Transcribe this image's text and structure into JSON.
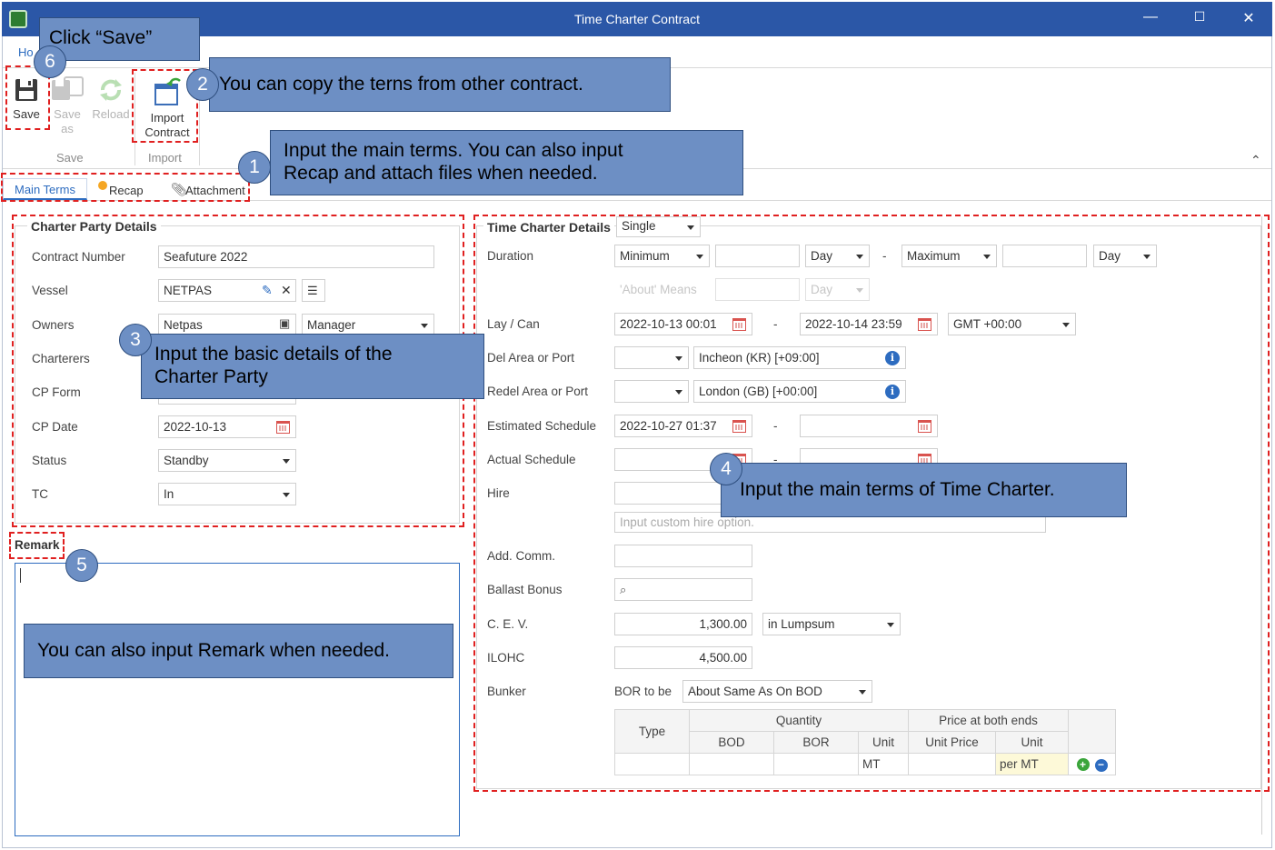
{
  "window": {
    "title": "Time Charter Contract",
    "minimize": "—",
    "maximize": "☐",
    "close": "✕"
  },
  "ribbon": {
    "home_tab": "Ho",
    "buttons": {
      "save": "Save",
      "save_as_1": "Save",
      "save_as_2": "as",
      "reload": "Reload",
      "import_1": "Import",
      "import_2": "Contract"
    },
    "groups": {
      "save": "Save",
      "import": "Import"
    },
    "collapse": "⌃"
  },
  "tabs": {
    "main_terms": "Main Terms",
    "recap": "Recap",
    "attachment": "Attachment"
  },
  "charter_party": {
    "title": "Charter Party Details",
    "contract_number_label": "Contract Number",
    "contract_number": "Seafuture 2022",
    "vessel_label": "Vessel",
    "vessel": "NETPAS",
    "owners_label": "Owners",
    "owners": "Netpas",
    "owners_role": "Manager",
    "charterers_label": "Charterers",
    "cp_form_label": "CP Form",
    "cp_date_label": "CP Date",
    "cp_date": "2022-10-13",
    "status_label": "Status",
    "status": "Standby",
    "tc_label": "TC",
    "tc": "In"
  },
  "remark": {
    "label": "Remark"
  },
  "time_charter": {
    "title": "Time Charter Details",
    "type": "Single",
    "duration_label": "Duration",
    "duration_min": "Minimum",
    "day_unit_1": "Day",
    "dash": "-",
    "duration_max": "Maximum",
    "day_unit_2": "Day",
    "about_means_placeholder": "'About' Means",
    "day_unit_3": "Day",
    "laycan_label": "Lay / Can",
    "lay_from": "2022-10-13 00:01",
    "lay_to": "2022-10-14 23:59",
    "timezone": "GMT +00:00",
    "del_label": "Del Area or Port",
    "del_port": "Incheon (KR) [+09:00]",
    "redel_label": "Redel Area or Port",
    "redel_port": "London (GB) [+00:00]",
    "est_label": "Estimated Schedule",
    "est_from": "2022-10-27 01:37",
    "act_label": "Actual Schedule",
    "hire_label": "Hire",
    "hire_custom_placeholder": "Input custom hire option.",
    "addcomm_label": "Add. Comm.",
    "ballast_label": "Ballast Bonus",
    "cev_label": "C. E. V.",
    "cev": "1,300.00",
    "cev_basis": "in Lumpsum",
    "ilohc_label": "ILOHC",
    "ilohc": "4,500.00",
    "bunker_label": "Bunker",
    "bor_label": "BOR to be",
    "bor_value": "About Same As On BOD",
    "table": {
      "type": "Type",
      "quantity": "Quantity",
      "price": "Price at both ends",
      "bod": "BOD",
      "bor": "BOR",
      "unit": "Unit",
      "unit_price": "Unit Price",
      "unit2": "Unit",
      "row_unit": "MT",
      "row_price_unit": "per MT"
    }
  },
  "callouts": {
    "c1": {
      "num": "1",
      "line1": "Input the main terms. You can also input",
      "line2": "Recap and attach files when needed."
    },
    "c2": {
      "num": "2",
      "text": "You can copy the terns from other contract."
    },
    "c3": {
      "num": "3",
      "line1": "Input the basic details of the",
      "line2": "Charter Party"
    },
    "c4": {
      "num": "4",
      "text": "Input the main terms of Time Charter."
    },
    "c5": {
      "num": "5",
      "text": "You can also input Remark when needed."
    },
    "c6": {
      "num": "6",
      "text": "Click “Save”"
    }
  },
  "colors": {
    "titlebar": "#2b57a7",
    "callout": "#6d8fc4",
    "annotation_border": "#e02020",
    "accent": "#2d6cc0"
  }
}
